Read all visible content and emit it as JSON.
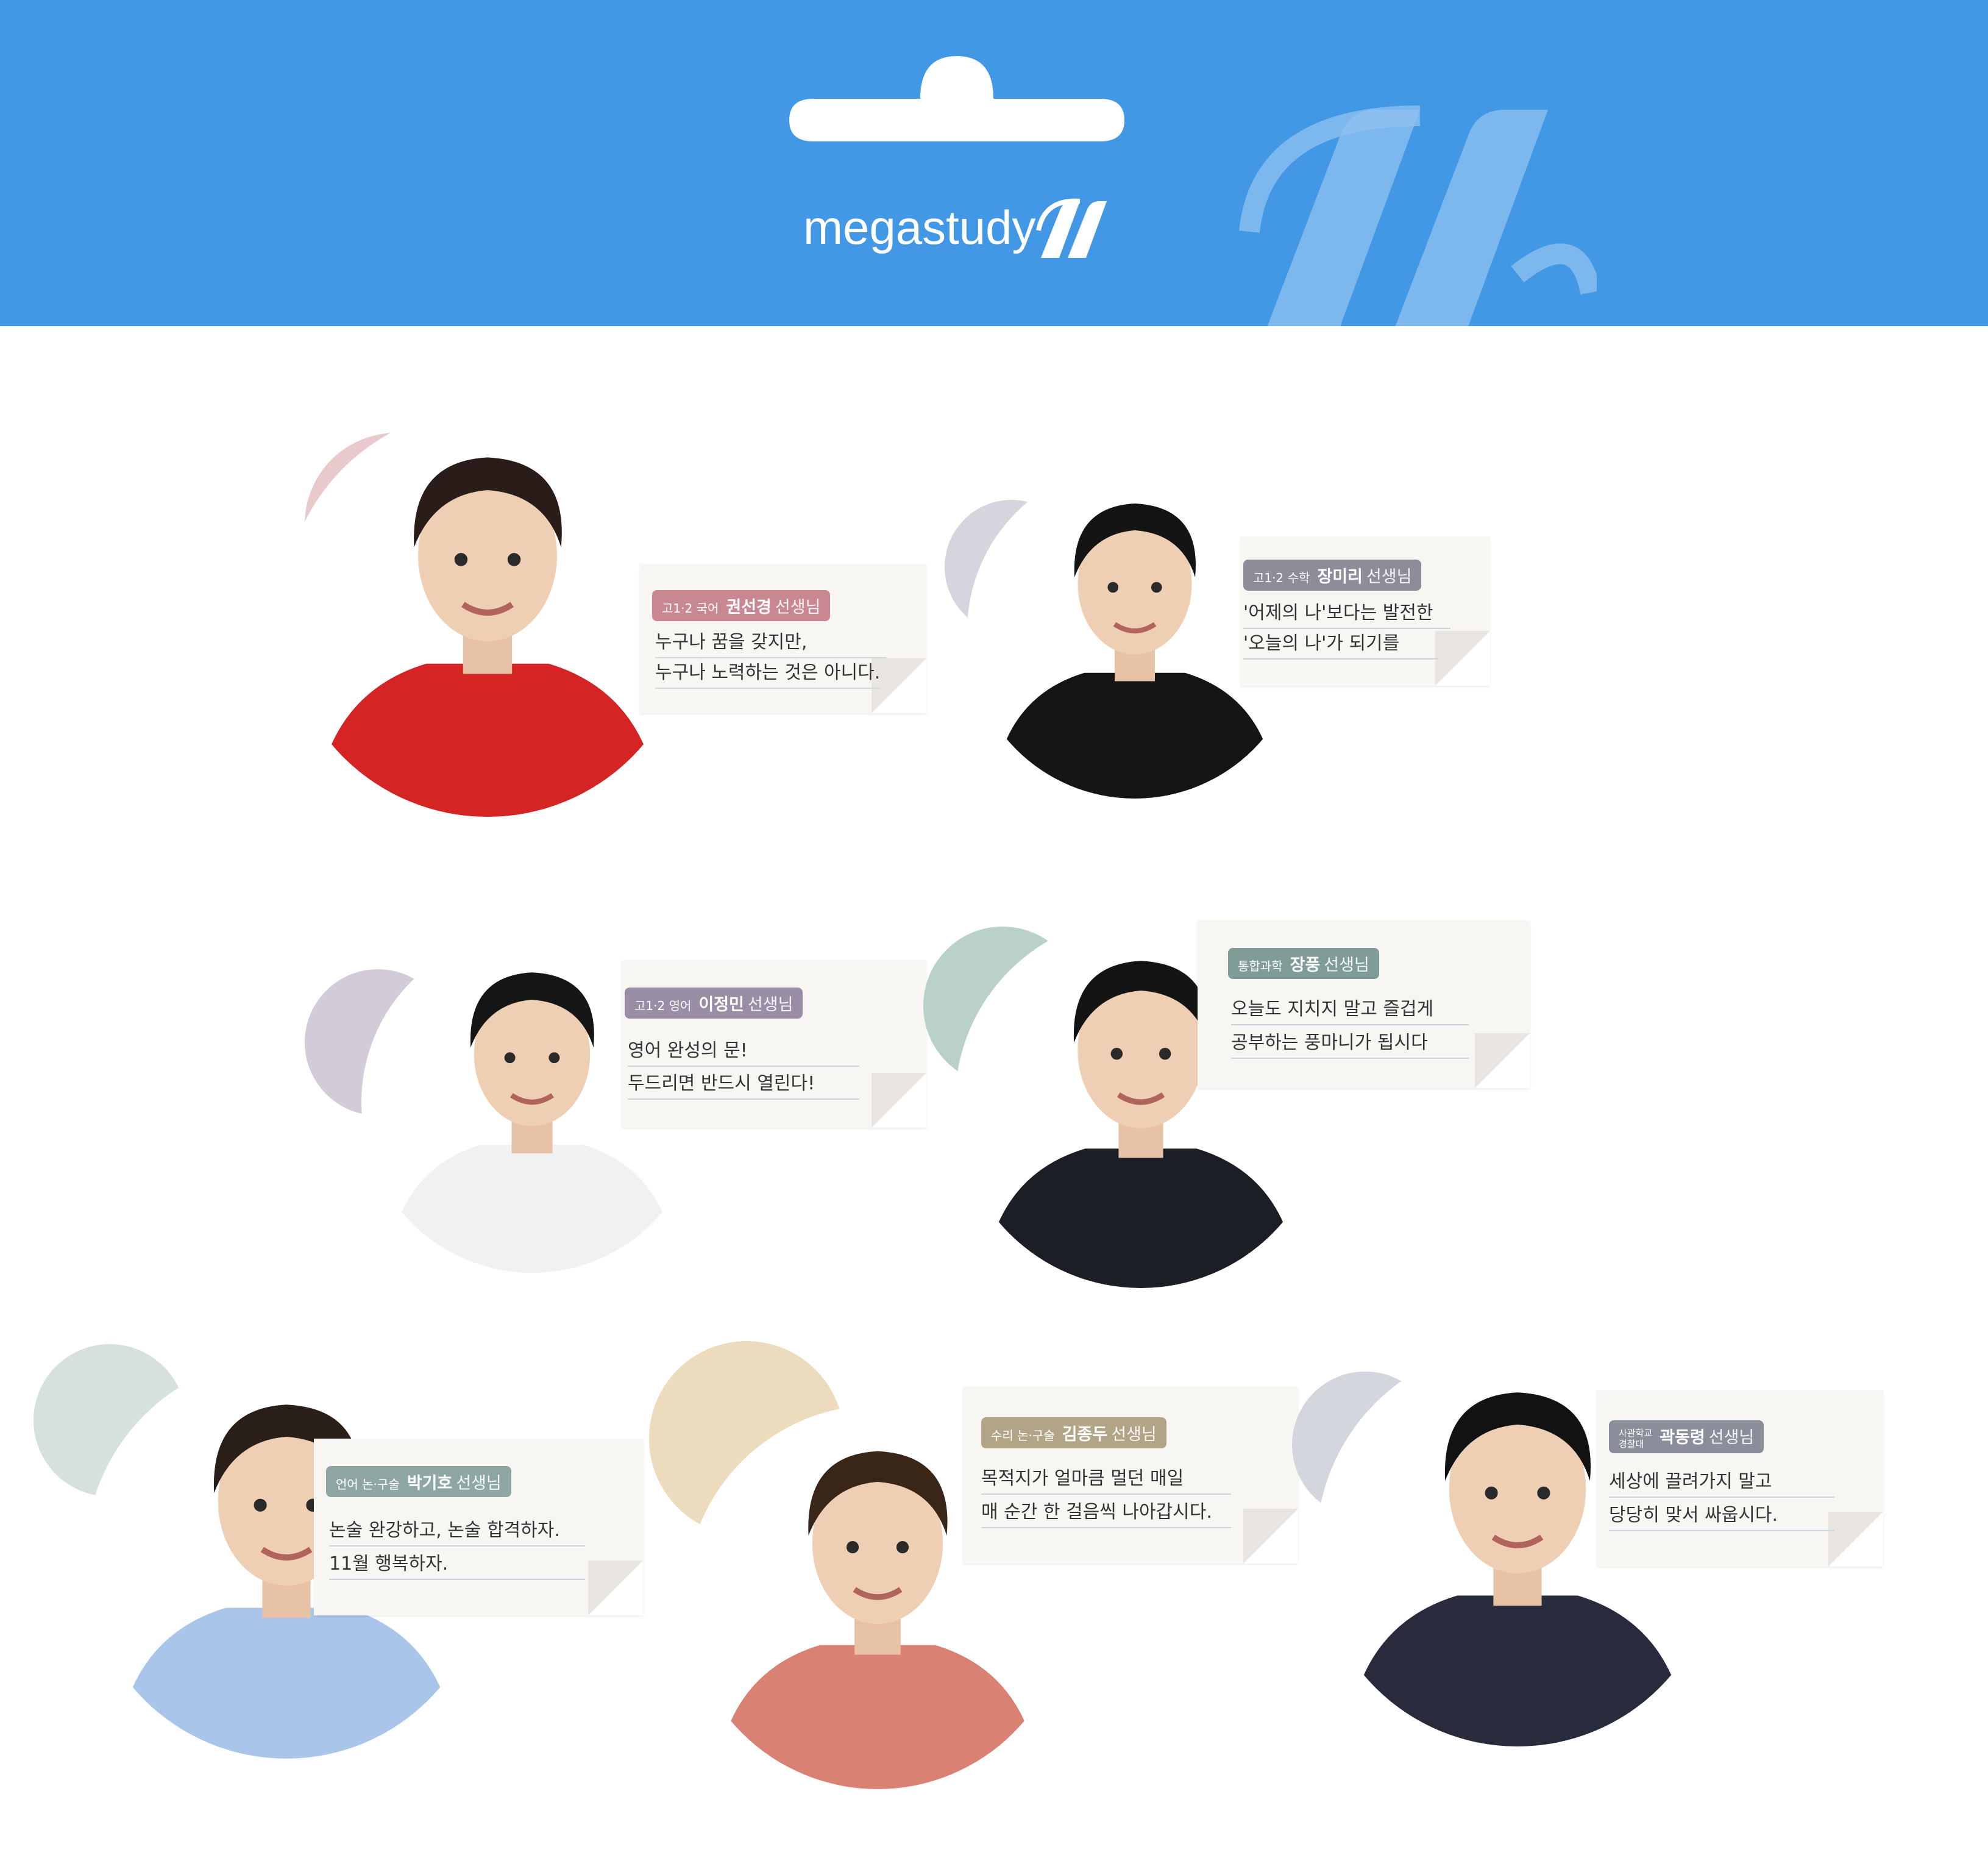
{
  "header": {
    "brand_text": "megastudy",
    "bg_color": "#4398e6",
    "hanger_icon": "hanger-hole-icon",
    "logo_icon": "megastudy-m-icon"
  },
  "teachers": [
    {
      "subject": "고1·2 국어",
      "name": "권선경",
      "title": "선생님",
      "line1": "누구나 꿈을 갖지만,",
      "line2": "누구나 노력하는 것은 아니다.",
      "tag_color": "#c98891",
      "blob_color": "#e8c9cc",
      "shirt": "#d42424",
      "hair": "#2a1c18"
    },
    {
      "subject": "고1·2 수학",
      "name": "장미리",
      "title": "선생님",
      "line1": "'어제의 나'보다는 발전한",
      "line2": "'오늘의 나'가 되기를",
      "tag_color": "#8f8b99",
      "blob_color": "#d6d4dc",
      "shirt": "#151515",
      "hair": "#141414"
    },
    {
      "subject": "고1·2 영어",
      "name": "이정민",
      "title": "선생님",
      "line1": "영어 완성의 문!",
      "line2": "두드리면 반드시 열린다!",
      "tag_color": "#9a8ea6",
      "blob_color": "#d3ccd8",
      "shirt": "#f1f1f1",
      "hair": "#151515"
    },
    {
      "subject": "통합과학",
      "name": "장풍",
      "title": "선생님",
      "line1": "오늘도 지치지 말고 즐겁게",
      "line2": "공부하는 풍마니가 됩시다",
      "tag_color": "#7f9c97",
      "blob_color": "#b9d0cb",
      "shirt": "#1b1e24",
      "hair": "#141414"
    },
    {
      "subject": "언어 논·구술",
      "name": "박기호",
      "title": "선생님",
      "line1": "논술 완강하고, 논술 합격하자.",
      "line2": "11월 행복하자.",
      "tag_color": "#8fa7a2",
      "blob_color": "#d6e1de",
      "shirt": "#a9c6ea",
      "hair": "#2a1f18"
    },
    {
      "subject": "수리 논·구술",
      "name": "김종두",
      "title": "선생님",
      "line1": "목적지가 얼마큼 멀던 매일",
      "line2": "매 순간 한 걸음씩 나아갑시다.",
      "tag_color": "#b2a486",
      "blob_color": "#ecdcbd",
      "shirt": "#d98172",
      "hair": "#3a2618"
    },
    {
      "subject_top": "사관학교",
      "subject_bottom": "경찰대",
      "name": "곽동령",
      "title": "선생님",
      "line1": "세상에 끌려가지 말고",
      "line2": "당당히 맞서 싸웁시다.",
      "tag_color": "#8a8e9a",
      "blob_color": "#d3d6dd",
      "shirt": "#272b3c",
      "hair": "#121212"
    }
  ]
}
